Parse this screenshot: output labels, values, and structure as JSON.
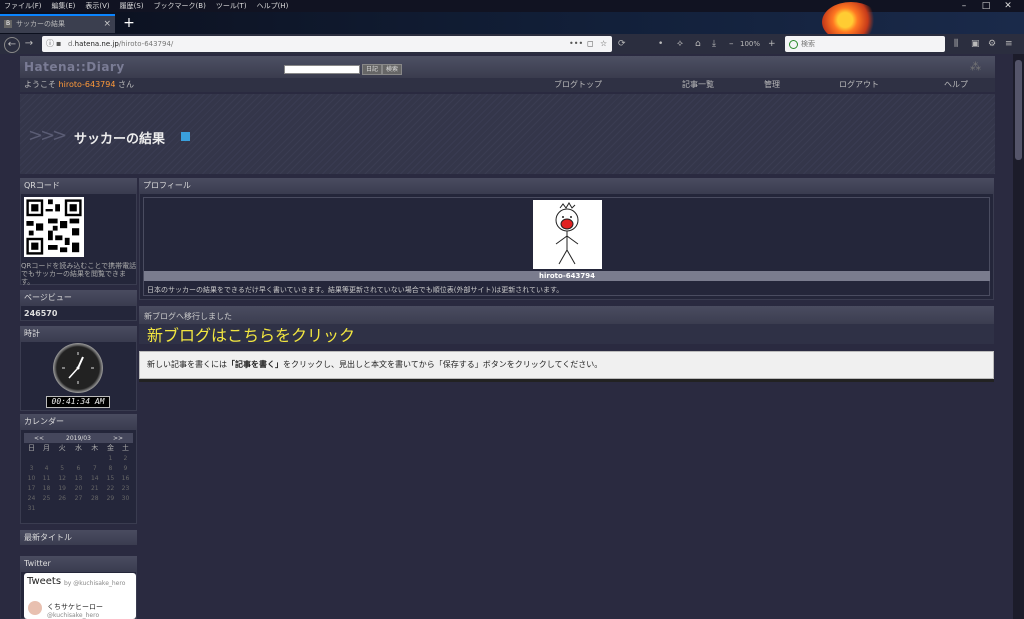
{
  "menubar": [
    "ファイル(F)",
    "編集(E)",
    "表示(V)",
    "履歴(S)",
    "ブックマーク(B)",
    "ツール(T)",
    "ヘルプ(H)"
  ],
  "tab": {
    "title": "サッカーの結果",
    "favicon": "B"
  },
  "window_controls": {
    "minimize": "–",
    "maximize": "□",
    "close": "✕"
  },
  "url": {
    "prefix": "d.",
    "domain": "hatena.ne.jp",
    "path": "/hiroto-643794/"
  },
  "url_icons": {
    "more": "•••",
    "pocket": "◻",
    "star": "☆"
  },
  "zoom": "100%",
  "search": {
    "placeholder": "検索"
  },
  "hatena": {
    "logo": "Hatena::Diary",
    "search_btn1": "日記",
    "search_btn2": "検索",
    "welcome_prefix": "ようこそ",
    "username": "hiroto-643794",
    "welcome_suffix": "さん",
    "nav": [
      "ブログトップ",
      "記事一覧",
      "管理",
      "ログアウト",
      "ヘルプ"
    ]
  },
  "blog": {
    "arrows": ">>>",
    "title": "サッカーの結果"
  },
  "sidebar": {
    "qr_heading": "QRコード",
    "qr_text": "QRコードを読み込むことで携帯電話でもサッカーの結果を閲覧できます。",
    "pageview_heading": "ページビュー",
    "pageview_count": "246570",
    "clock_heading": "時計",
    "clock_time": "00:41:34 AM",
    "calendar_heading": "カレンダー",
    "calendar": {
      "prev": "<<",
      "month": "2019/03",
      "next": ">>",
      "weekdays": [
        "日",
        "月",
        "火",
        "水",
        "木",
        "金",
        "土"
      ],
      "weeks": [
        [
          "",
          "",
          "",
          "",
          "",
          "1",
          "2"
        ],
        [
          "3",
          "4",
          "5",
          "6",
          "7",
          "8",
          "9"
        ],
        [
          "10",
          "11",
          "12",
          "13",
          "14",
          "15",
          "16"
        ],
        [
          "17",
          "18",
          "19",
          "20",
          "21",
          "22",
          "23"
        ],
        [
          "24",
          "25",
          "26",
          "27",
          "28",
          "29",
          "30"
        ],
        [
          "31",
          "",
          "",
          "",
          "",
          "",
          ""
        ]
      ]
    },
    "recent_heading": "最新タイトル",
    "twitter_heading": "Twitter",
    "twitter": {
      "tweets": "Tweets",
      "by": "by @kuchisake_hero",
      "name": "くちサケヒーロー",
      "handle": "@kuchisake_hero"
    }
  },
  "profile": {
    "heading": "プロフィール",
    "name": "hiroto-643794",
    "description": "日本のサッカーの結果をできるだけ早く書いていきます。結果等更新されていない場合でも順位表(外部サイト)は更新されています。"
  },
  "move": {
    "note": "新ブログへ移行しました",
    "link": "新ブログはこちらをクリック"
  },
  "notice": {
    "pre": "新しい記事を書くには",
    "bold": "「記事を書く」",
    "post": "をクリックし、見出しと本文を書いてから「保存する」ボタンをクリックしてください。"
  }
}
